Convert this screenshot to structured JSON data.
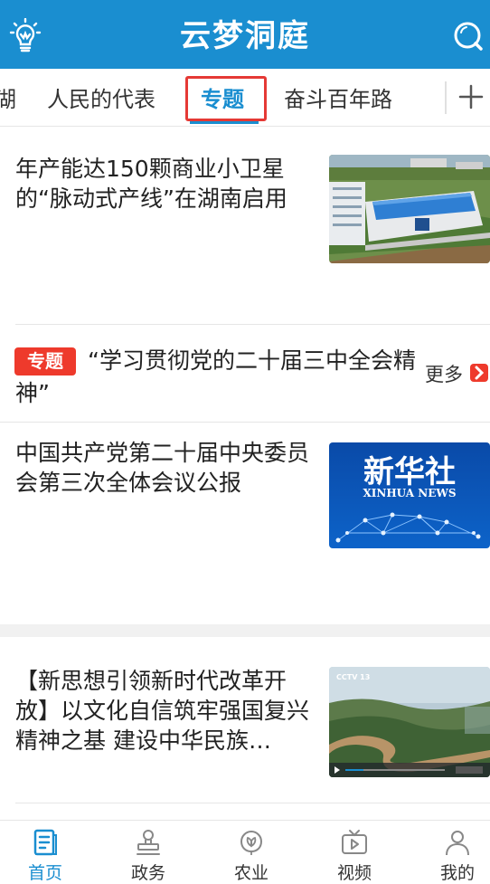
{
  "header": {
    "title": "云梦洞庭"
  },
  "tabs": {
    "partial": "湖",
    "items": [
      "人民的代表",
      "专题",
      "奋斗百年路"
    ],
    "active_index": 1
  },
  "articles": [
    {
      "headline": "年产能达150颗商业小卫星的“脉动式产线”在湖南启用"
    },
    {
      "headline": "中国共产党第二十届中央委员会第三次全体会议公报",
      "thumb_text_cn": "新华社",
      "thumb_text_en": "XINHUA NEWS"
    },
    {
      "headline": "【新思想引领新时代改革开放】以文化自信筑牢强国复兴精神之基 建设中华民族…",
      "thumb_logo": "CCTV 13"
    }
  ],
  "topic": {
    "badge": "专题",
    "text": "“学习贯彻党的二十届三中全会精神”",
    "more_label": "更多"
  },
  "bottom_nav": [
    {
      "label": "首页",
      "icon": "home-doc-icon",
      "active": true
    },
    {
      "label": "政务",
      "icon": "government-stamp-icon",
      "active": false
    },
    {
      "label": "农业",
      "icon": "agriculture-leaf-icon",
      "active": false
    },
    {
      "label": "视频",
      "icon": "tv-video-icon",
      "active": false
    },
    {
      "label": "我的",
      "icon": "user-icon",
      "active": false
    }
  ],
  "colors": {
    "brand": "#1a8ed0",
    "accent_red": "#ee3a2c"
  }
}
